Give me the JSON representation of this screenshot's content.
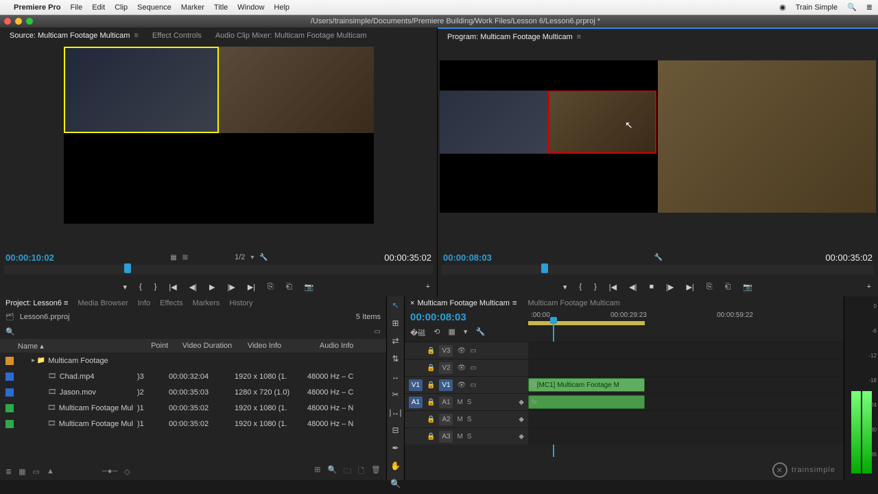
{
  "menubar": {
    "app": "Premiere Pro",
    "items": [
      "File",
      "Edit",
      "Clip",
      "Sequence",
      "Marker",
      "Title",
      "Window",
      "Help"
    ],
    "account": "Train Simple"
  },
  "titlebar": {
    "path": "/Users/trainsimple/Documents/Premiere Building/Work Files/Lesson 6/Lesson6.prproj *"
  },
  "source": {
    "tabs": [
      "Source: Multicam Footage Multicam",
      "Effect Controls",
      "Audio Clip Mixer: Multicam Footage Multicam"
    ],
    "tc_in": "00:00:10:02",
    "zoom": "1/2",
    "tc_out": "00:00:35:02"
  },
  "program": {
    "tab": "Program: Multicam Footage Multicam",
    "tc_in": "00:00:08:03",
    "tc_out": "00:00:35:02"
  },
  "project": {
    "tabs": [
      "Project: Lesson6",
      "Media Browser",
      "Info",
      "Effects",
      "Markers",
      "History"
    ],
    "file": "Lesson6.prproj",
    "items_label": "5 Items",
    "columns": [
      "Name",
      "Point",
      "Video Duration",
      "Video Info",
      "Audio Info"
    ],
    "rows": [
      {
        "chip": "#d98f2e",
        "indent": 16,
        "icon": "▸ 📁",
        "name": "Multicam Footage",
        "point": "",
        "dur": "",
        "vinfo": "",
        "ainfo": ""
      },
      {
        "chip": "#2d6bd4",
        "indent": 40,
        "icon": "🎞",
        "name": "Chad.mp4",
        "point": ")3",
        "dur": "00:00:32:04",
        "vinfo": "1920 x 1080 (1.",
        "ainfo": "48000 Hz – C"
      },
      {
        "chip": "#2d6bd4",
        "indent": 40,
        "icon": "🎞",
        "name": "Jason.mov",
        "point": ")2",
        "dur": "00:00:35:03",
        "vinfo": "1280 x 720 (1.0)",
        "ainfo": "48000 Hz – C"
      },
      {
        "chip": "#2da84a",
        "indent": 40,
        "icon": "🎞",
        "name": "Multicam Footage Mul",
        "point": ")1",
        "dur": "00:00:35:02",
        "vinfo": "1920 x 1080 (1.",
        "ainfo": "48000 Hz – N"
      },
      {
        "chip": "#2da84a",
        "indent": 40,
        "icon": "🎞",
        "name": "Multicam Footage Mul",
        "point": ")1",
        "dur": "00:00:35:02",
        "vinfo": "1920 x 1080 (1.",
        "ainfo": "48000 Hz – N"
      }
    ]
  },
  "timeline": {
    "tabs": [
      "Multicam Footage Multicam",
      "Multicam Footage Multicam"
    ],
    "tc": "00:00:08:03",
    "ruler": [
      ":00:00",
      "00:00:29:23",
      "00:00:59:22"
    ],
    "video_tracks": [
      {
        "sel": "",
        "name": "V3"
      },
      {
        "sel": "",
        "name": "V2"
      },
      {
        "sel": "V1",
        "name": "V1"
      }
    ],
    "audio_tracks": [
      {
        "sel": "A1",
        "name": "A1"
      },
      {
        "sel": "",
        "name": "A2"
      },
      {
        "sel": "",
        "name": "A3"
      }
    ],
    "clip_label": "[MC1] Multicam Footage M"
  },
  "meters": {
    "marks": [
      "0",
      "-6",
      "-12",
      "-18",
      "-24",
      "-30",
      "-36"
    ]
  },
  "logo": "trainsimple"
}
